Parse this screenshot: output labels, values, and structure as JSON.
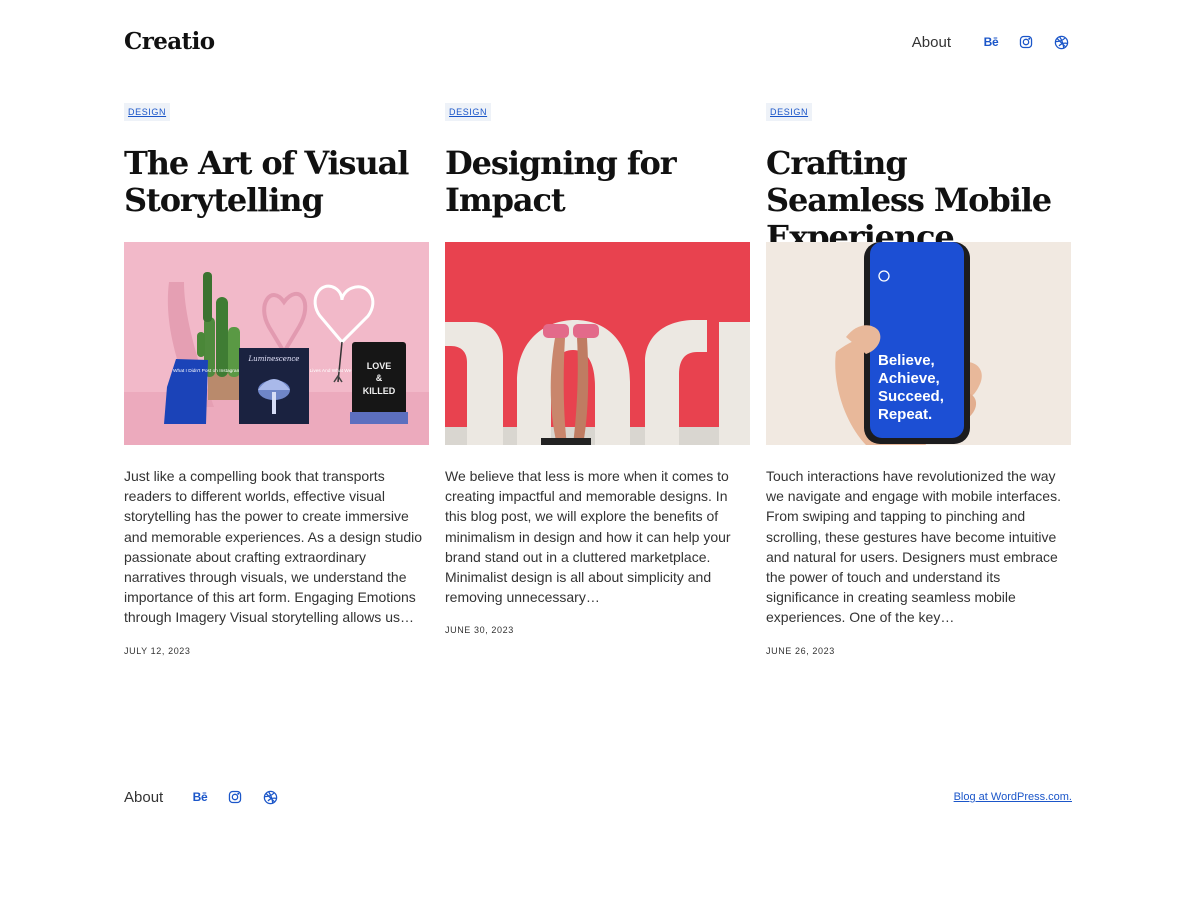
{
  "site": {
    "title": "Creatio"
  },
  "nav": {
    "about": "About",
    "icons": [
      "behance-icon",
      "instagram-icon",
      "dribbble-icon"
    ],
    "behance_text": "Bē"
  },
  "posts": [
    {
      "category": "DESIGN",
      "title": "The Art of Visual Storytelling",
      "image": "pink-still-life-books-cactus-neon-heart",
      "excerpt": "Just like a compelling book that transports readers to different worlds, effective visual storytelling has the power to create immersive and memorable experiences. As a design studio passionate about crafting extraordinary narratives through visuals, we understand the importance of this art form. Engaging Emotions through Imagery Visual storytelling allows us…",
      "date": "JULY 12, 2023"
    },
    {
      "category": "DESIGN",
      "title": "Designing for Impact",
      "image": "legs-upside-down-against-red-wall",
      "excerpt": "We believe that less is more when it comes to creating impactful and memorable designs. In this blog post, we will explore the benefits of minimalism in design and how it can help your brand stand out in a cluttered marketplace. Minimalist design is all about simplicity and removing unnecessary…",
      "date": "JUNE 30, 2023"
    },
    {
      "category": "DESIGN",
      "title": "Crafting Seamless Mobile Experience",
      "image": "hand-holding-phone-blue-screen",
      "excerpt": "Touch interactions have revolutionized the way we navigate and engage with mobile interfaces. From swiping and tapping to pinching and scrolling, these gestures have become intuitive and natural for users. Designers must embrace the power of touch and understand its significance in creating seamless mobile experiences. One of the key…",
      "date": "JUNE 26, 2023"
    }
  ],
  "images": {
    "book_small": "What I Didn't Post on Instagram: A Collection of Essays on Real Lives And What We Filter Out",
    "book_middle": "Luminescence",
    "book_right": [
      "LOVE",
      "&",
      "KILLED"
    ],
    "phone_text": [
      "Believe,",
      "Achieve,",
      "Succeed,",
      "Repeat."
    ]
  },
  "footer": {
    "about": "About",
    "credit": "Blog at WordPress.com."
  },
  "colors": {
    "accent": "#1b56c9",
    "tag_bg": "#eef2f8",
    "text": "#333333",
    "heading": "#111111"
  }
}
